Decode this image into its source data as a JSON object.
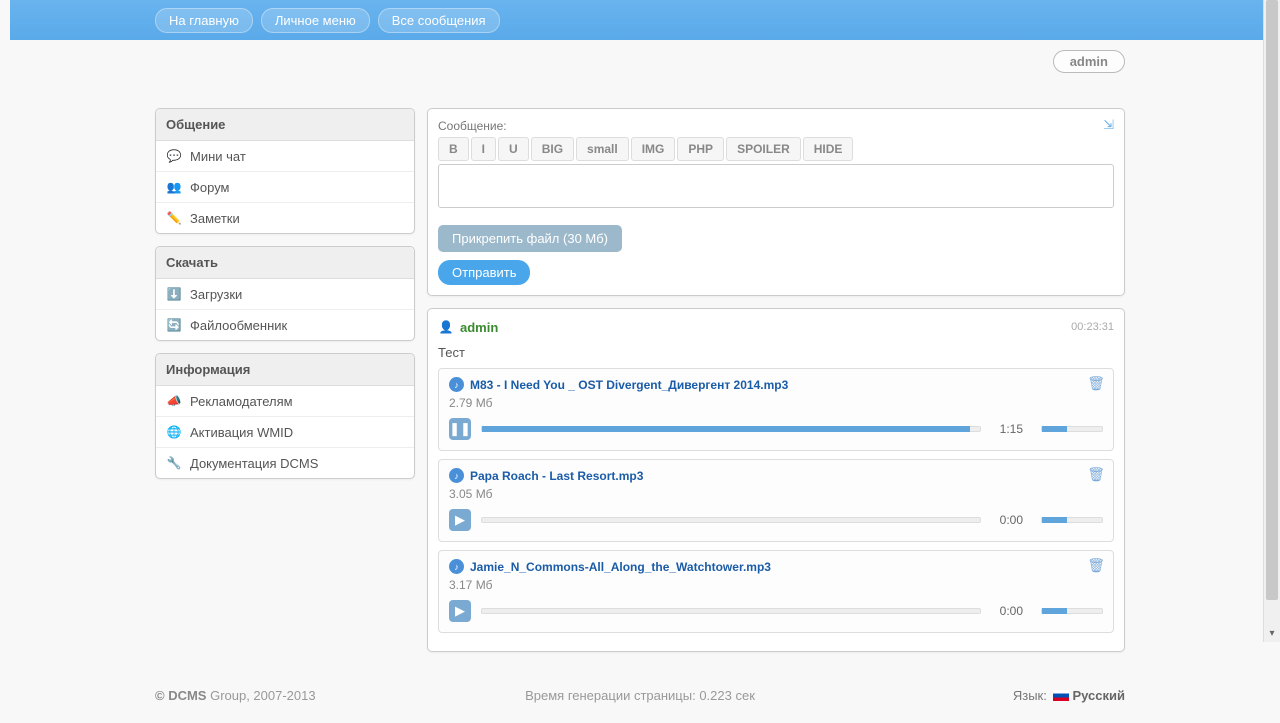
{
  "nav": {
    "home": "На главную",
    "personal": "Личное меню",
    "messages": "Все сообщения"
  },
  "user": "admin",
  "sidebar": {
    "sections": [
      {
        "title": "Общение",
        "items": [
          {
            "icon": "💬",
            "label": "Мини чат"
          },
          {
            "icon": "👥",
            "label": "Форум"
          },
          {
            "icon": "✏️",
            "label": "Заметки"
          }
        ]
      },
      {
        "title": "Скачать",
        "items": [
          {
            "icon": "⬇️",
            "label": "Загрузки"
          },
          {
            "icon": "🔄",
            "label": "Файлообменник"
          }
        ]
      },
      {
        "title": "Информация",
        "items": [
          {
            "icon": "📣",
            "label": "Рекламодателям"
          },
          {
            "icon": "🌐",
            "label": "Активация WMID"
          },
          {
            "icon": "🔧",
            "label": "Документация DCMS"
          }
        ]
      }
    ]
  },
  "editor": {
    "label": "Сообщение:",
    "buttons": [
      "B",
      "I",
      "U",
      "BIG",
      "small",
      "IMG",
      "PHP",
      "SPOILER",
      "HIDE"
    ],
    "attach": "Прикрепить файл (30 Мб)",
    "send": "Отправить"
  },
  "post": {
    "user": "admin",
    "time": "00:23:31",
    "text": "Тест",
    "attachments": [
      {
        "name": "M83 - I Need You _ OST Divergent_Дивергент 2014.mp3",
        "size": "2.79 Мб",
        "playing": true,
        "time": "1:15",
        "progress": 98
      },
      {
        "name": "Papa Roach - Last Resort.mp3",
        "size": "3.05 Мб",
        "playing": false,
        "time": "0:00",
        "progress": 0
      },
      {
        "name": "Jamie_N_Commons-All_Along_the_Watchtower.mp3",
        "size": "3.17 Мб",
        "playing": false,
        "time": "0:00",
        "progress": 0
      }
    ]
  },
  "footer": {
    "copyright_bold": "© DCMS",
    "copyright_rest": " Group, 2007-2013",
    "gen": "Время генерации страницы: 0.223 сек",
    "lang_label": "Язык: ",
    "lang": "Русский"
  }
}
